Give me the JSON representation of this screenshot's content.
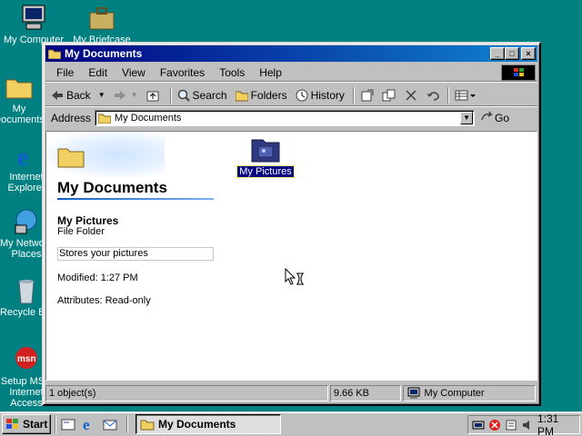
{
  "desktop": {
    "icons": [
      {
        "label": "My Computer"
      },
      {
        "label": "My Briefcase"
      },
      {
        "label": "My Documents"
      },
      {
        "label": "Internet Explorer"
      },
      {
        "label": "My Network Places"
      },
      {
        "label": "Recycle Bin"
      },
      {
        "label": "Setup MSN Internet Access"
      }
    ]
  },
  "window": {
    "title": "My Documents",
    "buttons": {
      "minimize": "_",
      "maximize": "□",
      "close": "×"
    }
  },
  "menu": [
    "File",
    "Edit",
    "View",
    "Favorites",
    "Tools",
    "Help"
  ],
  "toolbar": {
    "back": "Back",
    "search": "Search",
    "folders": "Folders",
    "history": "History"
  },
  "address": {
    "label": "Address",
    "value": "My Documents",
    "go": "Go"
  },
  "webview": {
    "header": "My Documents",
    "selected_name": "My Pictures",
    "selected_type": "File Folder",
    "description": "Stores your pictures",
    "modified": "Modified: 1:27 PM",
    "attributes": "Attributes: Read-only"
  },
  "files": [
    {
      "name": "My Pictures"
    }
  ],
  "status": {
    "count": "1 object(s)",
    "size": "9.66 KB",
    "zone": "My Computer"
  },
  "taskbar": {
    "start": "Start",
    "task": "My Documents",
    "clock": "1:31 PM"
  }
}
